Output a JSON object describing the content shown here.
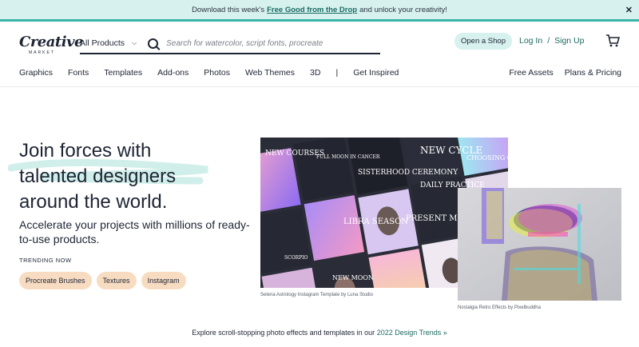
{
  "promo": {
    "prefix": "Download this week's",
    "link": "Free Good from the Drop",
    "suffix": "and unlock your creativity!",
    "close": "✕"
  },
  "header": {
    "logo": "Creative",
    "logo_sub": "MARKET",
    "category": "All Products",
    "search_placeholder": "Search for watercolor, script fonts, procreate",
    "open_shop": "Open a Shop",
    "login": "Log In",
    "slash": "/",
    "signup": "Sign Up"
  },
  "nav": {
    "items": [
      "Graphics",
      "Fonts",
      "Templates",
      "Add-ons",
      "Photos",
      "Web Themes",
      "3D"
    ],
    "separator": "|",
    "inspired": "Get Inspired",
    "right": [
      "Free Assets",
      "Plans & Pricing"
    ]
  },
  "hero": {
    "headline_1": "Join forces with",
    "headline_2": "talented designers",
    "headline_3": "around the world.",
    "subtext": "Accelerate your projects with millions of ready-to-use products.",
    "trending_label": "TRENDING NOW",
    "pills": [
      "Procreate Brushes",
      "Textures",
      "Instagram"
    ]
  },
  "images": {
    "collage_caption": "Selena Astrology Instagram Template by Luna Studio",
    "retro_caption": "Nostalgia Retro Effects by Pixelbuddha",
    "collage_texts": [
      "NEW COURSES",
      "FULL MOON IN CANCER",
      "SISTERHOOD CEREMONY",
      "NEW CYCLE",
      "DAILY PRACTICE",
      "CHOOSING OURSELVES",
      "LIBRA SEASON",
      "PRESENT MOMENT",
      "SCORPIO",
      "NEW MOON"
    ]
  },
  "footer_line": {
    "text": "Explore scroll-stopping photo effects and templates in our",
    "link": "2022 Design Trends »"
  },
  "colors": {
    "teal_bg": "#d6f1ee",
    "teal_link": "#1b6a62",
    "pill_bg": "#f8dcc2",
    "text": "#1d2433"
  }
}
